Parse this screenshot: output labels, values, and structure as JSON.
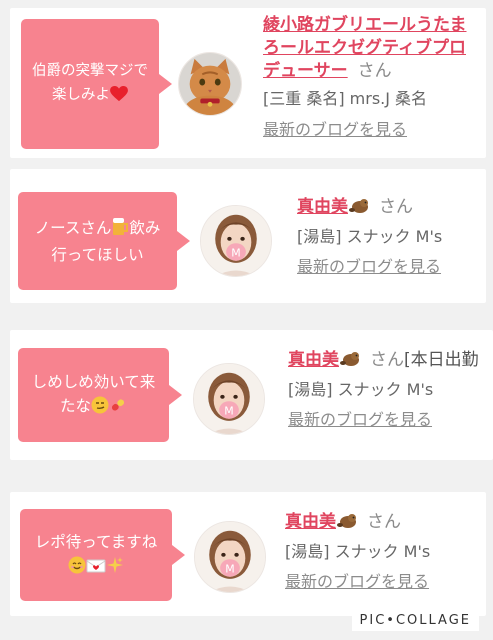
{
  "entries": [
    {
      "comment_parts": [
        "伯爵の突撃マジで",
        "楽しみよ"
      ],
      "comment_emoji": "heart-emoji",
      "name": "綾小路ガブリエールうたまろールエクゼグティブプロデューサー",
      "honorific": "さん",
      "extra": "",
      "shop": "[三重 桑名] mrs.J 桑名",
      "link": "最新のブログを見る",
      "avatar": "cat-avatar"
    },
    {
      "comment_parts": [
        "ノースさん",
        "飲み",
        "行ってほしい"
      ],
      "comment_emoji": "beer-emoji",
      "name": "真由美",
      "honorific": "さん",
      "extra": "",
      "shop": "[湯島] スナック M's",
      "link": "最新のブログを見る",
      "avatar": "woman-avatar"
    },
    {
      "comment_parts": [
        "しめしめ効いて来",
        "たな"
      ],
      "comment_emoji": "smirk-pill-emoji",
      "name": "真由美",
      "honorific": "さん",
      "extra": "[本日出勤",
      "shop": "[湯島] スナック M's",
      "link": "最新のブログを見る",
      "avatar": "woman-avatar"
    },
    {
      "comment_parts": [
        "レポ待ってますね",
        ""
      ],
      "comment_emoji": "smile-letter-sparkle-emoji",
      "name": "真由美",
      "honorific": "さん",
      "extra": "",
      "shop": "[湯島] スナック M's",
      "link": "最新のブログを見る",
      "avatar": "woman-avatar"
    }
  ],
  "watermark": "PIC•COLLAGE",
  "colors": {
    "bubble": "#f7838f",
    "name": "#e0455f",
    "background": "#f1f1f1"
  }
}
